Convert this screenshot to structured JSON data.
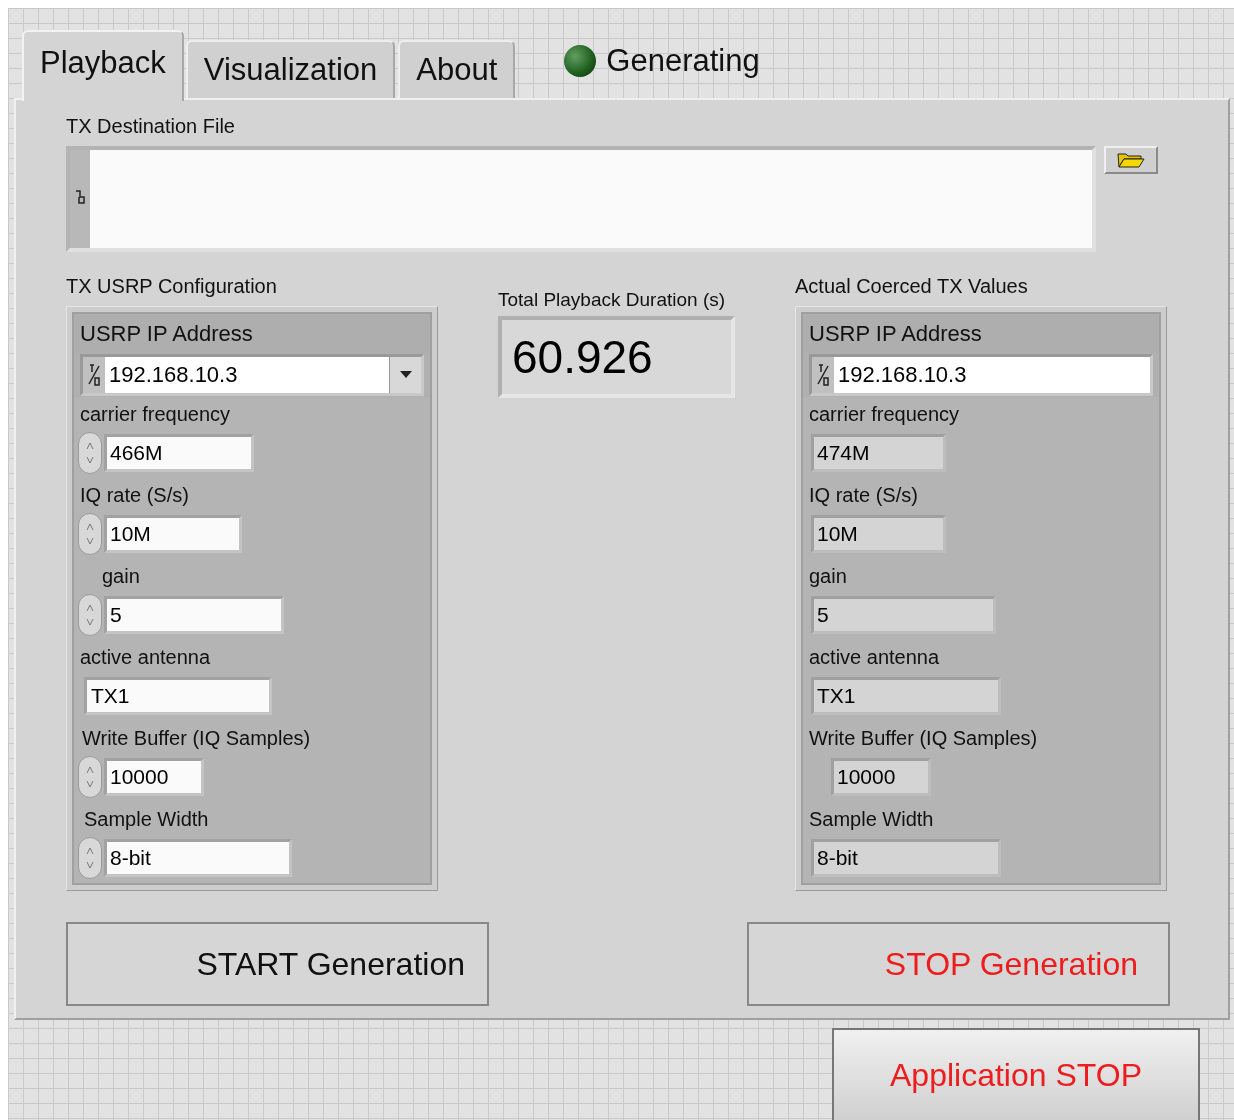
{
  "tabs": [
    {
      "label": "Playback",
      "selected": true
    },
    {
      "label": "Visualization",
      "selected": false
    },
    {
      "label": "About",
      "selected": false
    }
  ],
  "status_indicator": {
    "label": "Generating",
    "on": false
  },
  "destination_file": {
    "label": "TX Destination File"
  },
  "tx_config": {
    "title": "TX USRP Configuration",
    "ip": {
      "label": "USRP IP Address",
      "value": "192.168.10.3",
      "kind": "combo"
    },
    "fields": [
      {
        "label": "carrier frequency",
        "value": "466M",
        "kind": "numeric"
      },
      {
        "label": "IQ rate (S/s)",
        "value": "10M",
        "kind": "numeric"
      },
      {
        "label": "gain",
        "value": "5",
        "kind": "numeric"
      },
      {
        "label": "active antenna",
        "value": "TX1",
        "kind": "string"
      },
      {
        "label": "Write Buffer (IQ Samples)",
        "value": "10000",
        "kind": "numeric"
      },
      {
        "label": "Sample Width",
        "value": "8-bit",
        "kind": "numeric"
      }
    ]
  },
  "duration": {
    "label": "Total Playback Duration (s)",
    "value": "60.926"
  },
  "coerced": {
    "title": "Actual Coerced TX Values",
    "ip": {
      "label": "USRP IP Address",
      "value": "192.168.10.3",
      "kind": "plain"
    },
    "fields": [
      {
        "label": "carrier frequency",
        "value": "474M",
        "kind": "indicator"
      },
      {
        "label": "IQ rate (S/s)",
        "value": "10M",
        "kind": "indicator"
      },
      {
        "label": "gain",
        "value": "5",
        "kind": "indicator"
      },
      {
        "label": "active antenna",
        "value": "TX1",
        "kind": "indicator"
      },
      {
        "label": "Write Buffer (IQ Samples)",
        "value": "10000",
        "kind": "indicator"
      },
      {
        "label": "Sample Width",
        "value": "8-bit",
        "kind": "indicator"
      }
    ]
  },
  "buttons": [
    {
      "label": "START Generation",
      "kind": "start"
    },
    {
      "label": "STOP Generation",
      "kind": "stop"
    }
  ],
  "app_stop": {
    "label": "Application STOP"
  }
}
